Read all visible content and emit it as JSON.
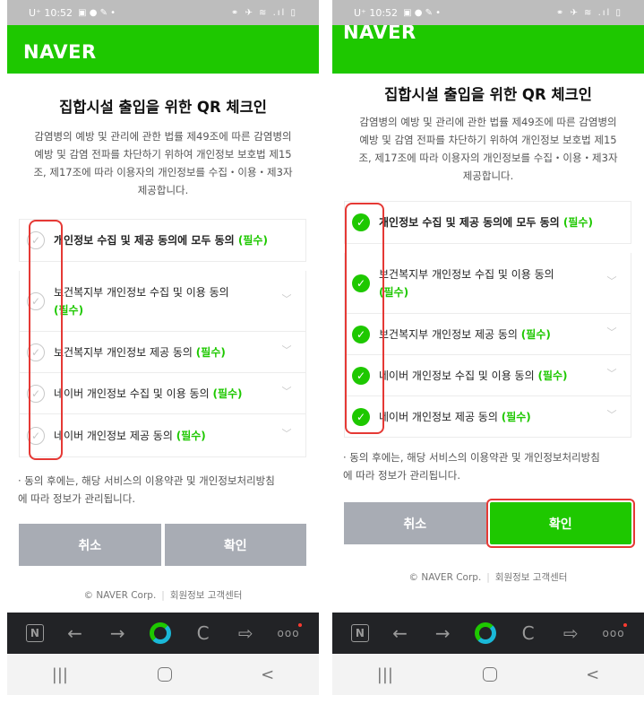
{
  "status": {
    "time": "U⁺ 10:52",
    "left_icons": "▣ ● ✎ •",
    "right_icons": "⚭ ✈ ≋ .ıl ▯"
  },
  "brand": "NAVER",
  "title": "집합시설 출입을 위한 QR 체크인",
  "left_desc": [
    "감염병의 예방 및 관리에 관한 법률 제49조에 따른 감염병의",
    "예방 및 감염 전파를 차단하기 위하여 개인정보 보호법 제15",
    "조, 제17조에 따라 이용자의 개인정보를 수집・이용・제3자",
    "제공합니다."
  ],
  "right_desc": [
    "감염병의 예방 및 관리에 관한 법률 제49조에 따른 감염병의",
    "예방 및 감염 전파를 차단하기 위하여 개인정보 보호법 제15",
    "조, 제17조에 따라 이용자의 개인정보를 수집・이용・제3자",
    "제공합니다."
  ],
  "required_label": "(필수)",
  "consents": {
    "all": "개인정보 수집 및 제공 동의에 모두 동의",
    "item1": "보건복지부 개인정보 수집 및 이용 동의",
    "item2": "보건복지부 개인정보 제공 동의",
    "item3": "네이버 개인정보 수집 및 이용 동의",
    "item4": "네이버 개인정보 제공 동의"
  },
  "left_checked": false,
  "right_checked": true,
  "note_lines": [
    "· 동의 후에는, 해당 서비스의 이용약관 및 개인정보처리방침",
    "에 따라 정보가 관리됩니다."
  ],
  "buttons": {
    "cancel": "취소",
    "confirm": "확인"
  },
  "footer": {
    "copyright": "© NAVER Corp.",
    "separator": "|",
    "link": "회원정보 고객센터"
  },
  "browser_nav": {
    "n": "N",
    "back": "←",
    "forward": "→",
    "refresh": "C",
    "share": "⇨",
    "more": "ooo"
  },
  "system_nav": {
    "recent": "|||",
    "back": "<"
  },
  "colors": {
    "accent": "#1ec800",
    "button_gray": "#a8acb4",
    "highlight": "#e53935"
  }
}
